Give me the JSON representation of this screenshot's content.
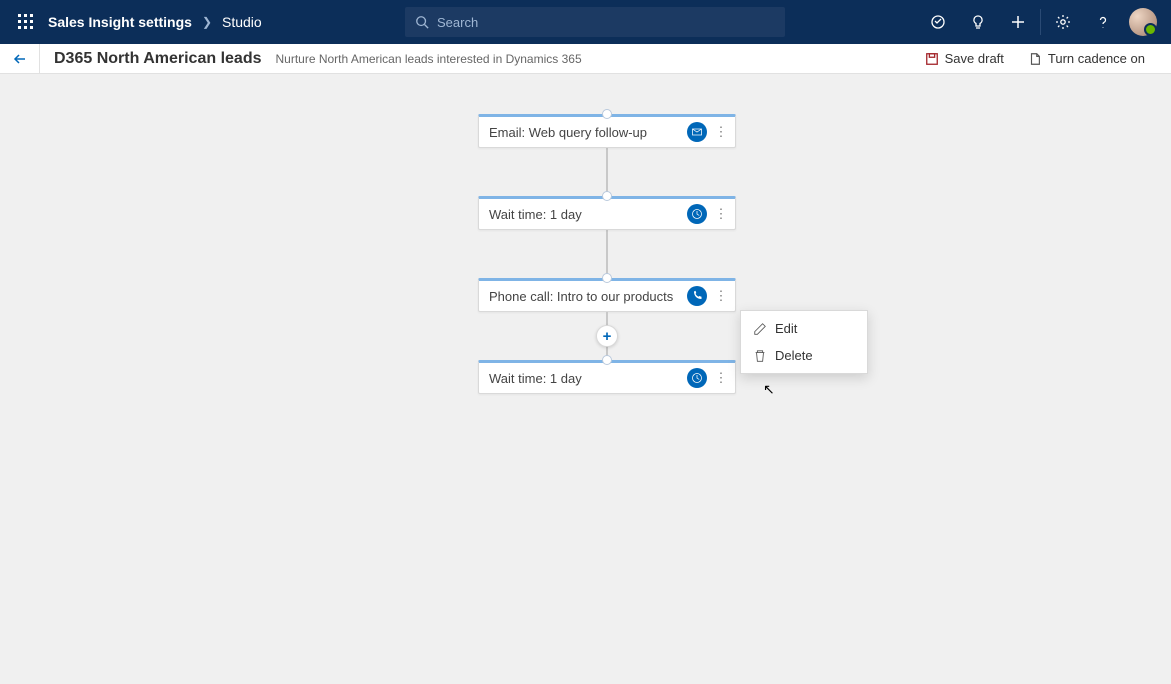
{
  "header": {
    "breadcrumb1": "Sales Insight settings",
    "breadcrumb2": "Studio",
    "search_placeholder": "Search"
  },
  "subheader": {
    "title": "D365 North American leads",
    "description": "Nurture North American leads interested in Dynamics 365",
    "save_label": "Save draft",
    "toggle_label": "Turn cadence on"
  },
  "nodes": [
    {
      "label": "Email: Web query follow-up",
      "type": "email"
    },
    {
      "label": "Wait time: 1 day",
      "type": "wait"
    },
    {
      "label": "Phone call: Intro to our products",
      "type": "phone"
    },
    {
      "label": "Wait time: 1 day",
      "type": "wait"
    }
  ],
  "context_menu": {
    "edit": "Edit",
    "delete": "Delete"
  }
}
